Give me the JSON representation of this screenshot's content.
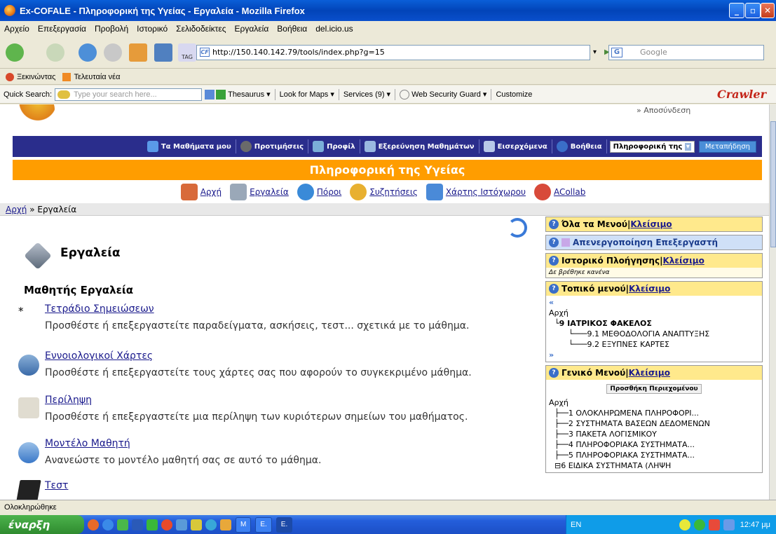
{
  "window": {
    "title": "Ex-COFALE - Πληροφορική της Υγείας - Εργαλεία - Mozilla Firefox"
  },
  "menubar": [
    "Αρχείο",
    "Επεξεργασία",
    "Προβολή",
    "Ιστορικό",
    "Σελιδοδείκτες",
    "Εργαλεία",
    "Βοήθεια",
    "del.icio.us"
  ],
  "navbar": {
    "url": "http://150.140.142.79/tools/index.php?g=15",
    "search_placeholder": "Google",
    "tag_label": "TAG"
  },
  "bookmarks": [
    "Ξεκινώντας",
    "Τελευταία νέα"
  ],
  "quickbar": {
    "label": "Quick Search:",
    "placeholder": "Type your search here...",
    "thesaurus": "Thesaurus",
    "maps": "Look for Maps",
    "services": "Services (9)",
    "guard": "Web Security Guard",
    "customize": "Customize",
    "brand": "Crawler"
  },
  "site": {
    "logout": "» Αποσύνδεση",
    "mainnav": [
      "Τα Μαθήματα μου",
      "Προτιμήσεις",
      "Προφίλ",
      "Εξερεύνηση Μαθημάτων",
      "Εισερχόμενα",
      "Βοήθεια"
    ],
    "course_select": "Πληροφορική της",
    "go_button": "Μεταπήδηση",
    "course_title": "Πληροφορική της Υγείας",
    "toolnav": [
      "Αρχή",
      "Εργαλεία",
      "Πόροι",
      "Συζητήσεις",
      "Χάρτης Ιστόχωρου",
      "ACollab"
    ],
    "breadcrumb": {
      "home": "Αρχή",
      "sep": " » ",
      "current": "Εργαλεία"
    }
  },
  "content": {
    "title": "Εργαλεία",
    "subtitle": "Μαθητής Εργαλεία",
    "tools": [
      {
        "name": "Τετράδιο Σημειώσεων",
        "desc": "Προσθέστε ή επεξεργαστείτε παραδείγματα, ασκήσεις, τεστ... σχετικά με το μάθημα."
      },
      {
        "name": "Εννοιολογικοί Χάρτες",
        "desc": "Προσθέστε ή επεξεργαστείτε τους χάρτες σας που αφορούν το συγκεκριμένο μάθημα."
      },
      {
        "name": "Περίληψη",
        "desc": "Προσθέστε ή επεξεργαστείτε μια περίληψη των κυριότερων σημείων του μαθήματος."
      },
      {
        "name": "Μοντέλο Μαθητή",
        "desc": "Ανανεώστε το μοντέλο μαθητή σας σε αυτό το μάθημα."
      },
      {
        "name": "Τεστ",
        "desc": ""
      }
    ],
    "bullet": "*"
  },
  "sidebar": {
    "all_menus": "Όλα τα Μενού",
    "close": "Κλείσιμο",
    "sep": " | ",
    "disable_editor": "Απενεργοποίηση Επεξεργαστή",
    "history": "Ιστορικό Πλοήγησης",
    "history_empty": "Δε βρέθηκε κανένα",
    "local_menu": "Τοπικό μενού",
    "local_items": [
      "Αρχή",
      "9 ΙΑΤΡΙΚΟΣ ΦΑΚΕΛΟΣ",
      "9.1 ΜΕΘΟΔΟΛΟΓΙΑ ΑΝΑΠΤΥΞΗΣ",
      "9.2 ΕΞΥΠΝΕΣ ΚΑΡΤΕΣ"
    ],
    "global_menu": "Γενικό Μενού",
    "add_content": "Προσθήκη Περιεχομένου",
    "global_items": [
      "Αρχή",
      "1 ΟΛΟΚΛΗΡΩΜΕΝΑ ΠΛΗΡΟΦΟΡΙ...",
      "2 ΣΥΣΤΗΜΑΤΑ ΒΑΣΕΩΝ ΔΕΔΟΜΕΝΩΝ",
      "3 ΠΑΚΕΤΑ ΛΟΓΙΣΜΙΚΟΥ",
      "4 ΠΛΗΡΟΦΟΡΙΑΚΑ ΣΥΣΤΗΜΑΤΑ...",
      "5 ΠΛΗΡΟΦΟΡΙΑΚΑ ΣΥΣΤΗΜΑΤΑ...",
      "6 ΕΙΔΙΚΑ ΣΥΣΤΗΜΑΤΑ (ΛΗΨΗ"
    ]
  },
  "status": "Ολοκληρώθηκε",
  "taskbar": {
    "start": "έναρξη",
    "tasks": [
      "M",
      "E.",
      "E."
    ],
    "lang": "EN",
    "clock": "12:47 μμ"
  },
  "colors": {
    "blue_nav": "#2a2d8c",
    "orange_bar": "#ff9d00",
    "menu_header": "#ffe98c"
  }
}
